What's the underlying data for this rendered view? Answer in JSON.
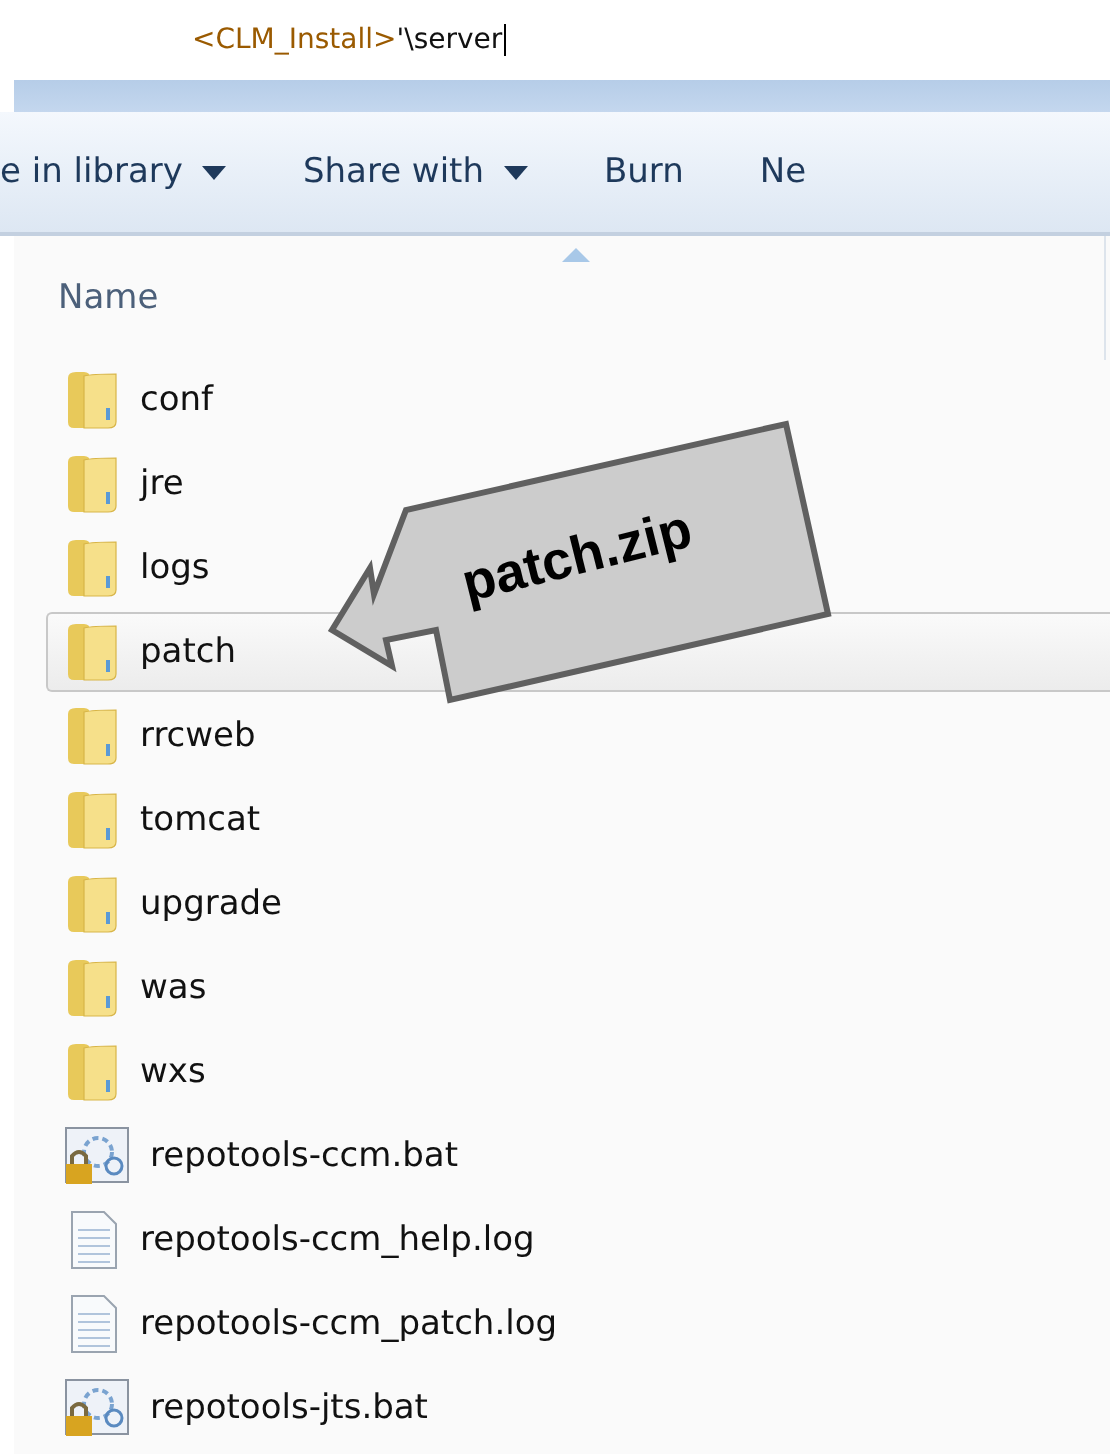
{
  "address": {
    "placeholder_part": "<CLM_Install>",
    "typed_part": "'\\server"
  },
  "toolbar": [
    {
      "label": "e in library",
      "dropdown": true
    },
    {
      "label": "Share with",
      "dropdown": true
    },
    {
      "label": "Burn",
      "dropdown": false
    },
    {
      "label": "Ne",
      "dropdown": false
    }
  ],
  "column_header": {
    "label": "Name",
    "sorted": true
  },
  "files": [
    {
      "name": "conf",
      "kind": "folder",
      "selected": false
    },
    {
      "name": "jre",
      "kind": "folder",
      "selected": false
    },
    {
      "name": "logs",
      "kind": "folder",
      "selected": false
    },
    {
      "name": "patch",
      "kind": "folder",
      "selected": true
    },
    {
      "name": "rrcweb",
      "kind": "folder",
      "selected": false
    },
    {
      "name": "tomcat",
      "kind": "folder",
      "selected": false
    },
    {
      "name": "upgrade",
      "kind": "folder",
      "selected": false
    },
    {
      "name": "was",
      "kind": "folder",
      "selected": false
    },
    {
      "name": "wxs",
      "kind": "folder",
      "selected": false
    },
    {
      "name": "repotools-ccm.bat",
      "kind": "batch",
      "selected": false
    },
    {
      "name": "repotools-ccm_help.log",
      "kind": "text",
      "selected": false
    },
    {
      "name": "repotools-ccm_patch.log",
      "kind": "text",
      "selected": false
    },
    {
      "name": "repotools-jts.bat",
      "kind": "batch",
      "selected": false
    }
  ],
  "callout": {
    "text": "patch.zip"
  }
}
